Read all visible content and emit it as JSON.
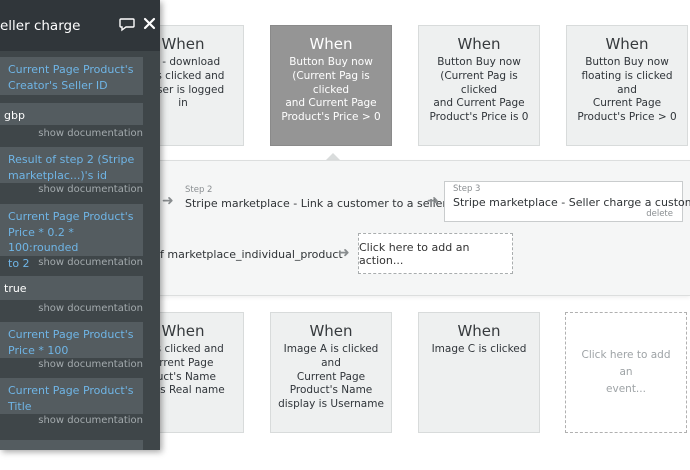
{
  "events_top": [
    {
      "when": "When",
      "condition": "on - download\nw is clicked and\nt User is logged\nin",
      "active": false
    },
    {
      "when": "When",
      "condition": "Button Buy now\n(Current Pag is clicked\nand Current Page\nProduct's Price > 0",
      "active": true
    },
    {
      "when": "When",
      "condition": "Button Buy now\n(Current Pag is clicked\nand Current Page\nProduct's Price is 0",
      "active": false
    },
    {
      "when": "When",
      "condition": "Button Buy now\nfloating is clicked and\nCurrent Page\nProduct's Price > 0",
      "active": false
    }
  ],
  "events_bottom": [
    {
      "when": "When",
      "condition": "A is clicked and\nurrent Page\nduct's Name\nay is Real name"
    },
    {
      "when": "When",
      "condition": "Image A is clicked and\nCurrent Page\nProduct's Name\ndisplay is Username"
    },
    {
      "when": "When",
      "condition": "Image C is clicked"
    }
  ],
  "add_event_label": "Click here to add an\nevent...",
  "workflow": {
    "step2": {
      "num": "Step 2",
      "title": "Stripe marketplace - Link a customer to a seller"
    },
    "step3": {
      "num": "Step 3",
      "title": "Stripe marketplace - Seller charge a customer",
      "delete": "delete"
    },
    "action_text": "f marketplace_individual_product",
    "add_action": "Click here to add an action..."
  },
  "panel": {
    "title": "eller charge",
    "fields": [
      {
        "value": "Current Page Product's\nCreator's Seller ID",
        "link": true
      },
      {
        "value": "gbp",
        "link": false
      },
      {
        "value": "Result of step 2 (Stripe\nmarketplac...)'s id",
        "link": true
      },
      {
        "value": "Current Page Product's\nPrice * 0.2 * 100:rounded\nto 2",
        "link": true
      },
      {
        "value": "true",
        "link": false
      },
      {
        "value": "Current Page Product's\nPrice * 100",
        "link": true
      },
      {
        "value": "Current Page Product's\nTitle",
        "link": true
      }
    ],
    "show_doc": "show documentation"
  }
}
